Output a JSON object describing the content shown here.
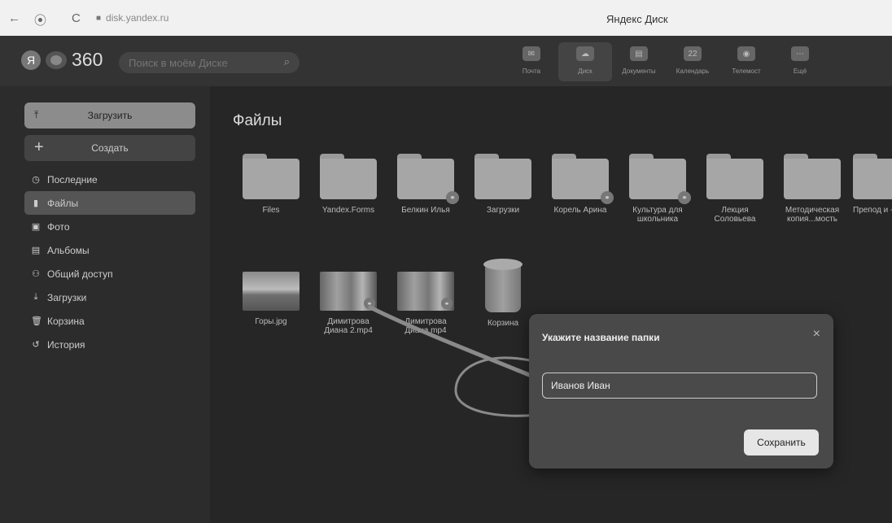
{
  "browser": {
    "back": "←",
    "shield": "⦿",
    "reload": "C",
    "url": "disk.yandex.ru",
    "tab_title": "Яндекс Диск"
  },
  "header": {
    "logo_ya": "Я",
    "logo_text": "360",
    "search_placeholder": "Поиск в моём Диске",
    "services": [
      {
        "label": "Почта",
        "icon": "mail-icon",
        "glyph": "✉"
      },
      {
        "label": "Диск",
        "icon": "disk-icon",
        "glyph": "☁"
      },
      {
        "label": "Документы",
        "icon": "documents-icon",
        "glyph": "▤"
      },
      {
        "label": "Календарь",
        "icon": "calendar-icon",
        "glyph": "22"
      },
      {
        "label": "Телемост",
        "icon": "telemost-icon",
        "glyph": "◉"
      },
      {
        "label": "Ещё",
        "icon": "more-icon",
        "glyph": "⋯"
      }
    ]
  },
  "sidebar": {
    "upload_label": "Загрузить",
    "create_label": "Создать",
    "items": [
      {
        "label": "Последние",
        "icon": "clock-icon",
        "glyph": "◷"
      },
      {
        "label": "Файлы",
        "icon": "file-icon",
        "glyph": "▮"
      },
      {
        "label": "Фото",
        "icon": "photo-icon",
        "glyph": "▣"
      },
      {
        "label": "Альбомы",
        "icon": "album-icon",
        "glyph": "▤"
      },
      {
        "label": "Общий доступ",
        "icon": "shared-icon",
        "glyph": "⚇"
      },
      {
        "label": "Загрузки",
        "icon": "download-icon",
        "glyph": "⤓"
      },
      {
        "label": "Корзина",
        "icon": "trash-icon",
        "glyph": "🗑"
      },
      {
        "label": "История",
        "icon": "history-icon",
        "glyph": "↺"
      }
    ],
    "active_index": 1
  },
  "main": {
    "title": "Файлы",
    "folders": [
      {
        "name": "Files",
        "shared": false
      },
      {
        "name": "Yandex.Forms",
        "shared": false
      },
      {
        "name": "Белкин Илья",
        "shared": true
      },
      {
        "name": "Загрузки",
        "shared": false
      },
      {
        "name": "Корель Арина",
        "shared": true
      },
      {
        "name": "Культура для школьника",
        "shared": true
      },
      {
        "name": "Лекция Соловьева",
        "shared": false
      },
      {
        "name": "Методическая копия...мость",
        "shared": false
      },
      {
        "name": "Препод и - до...",
        "shared": false
      }
    ],
    "files": [
      {
        "name": "Горы.jpg",
        "kind": "image"
      },
      {
        "name": "Димитрова Диана 2.mp4",
        "kind": "video"
      },
      {
        "name": "Димитрова Диана.mp4",
        "kind": "video"
      },
      {
        "name": "Корзина",
        "kind": "trash"
      }
    ]
  },
  "dialog": {
    "title": "Укажите название папки",
    "close_glyph": "×",
    "input_value": "Иванов Иван",
    "save_label": "Сохранить"
  }
}
